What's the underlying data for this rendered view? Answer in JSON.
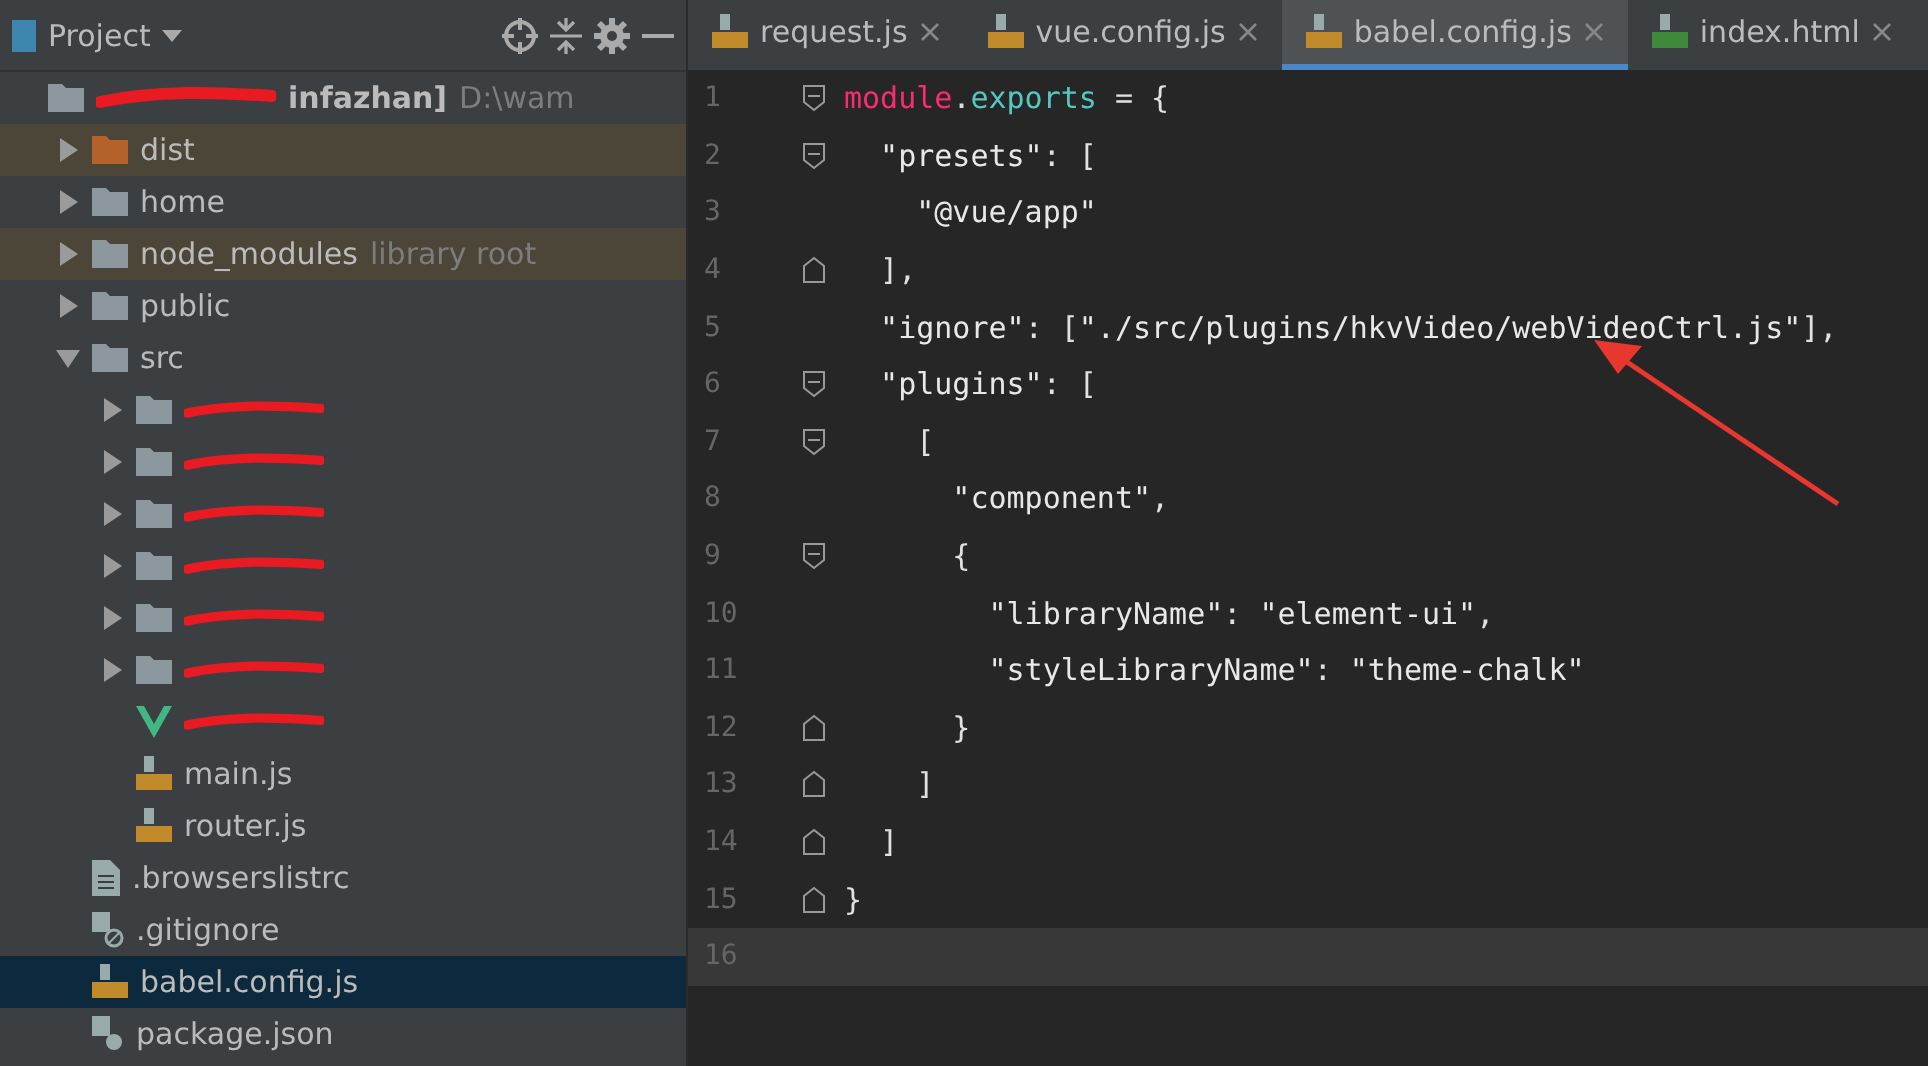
{
  "project_panel": {
    "title": "Project",
    "tree": [
      {
        "name": "infazhan]",
        "kind": "module",
        "redacted": true,
        "note": "D:\\wam",
        "children": [
          {
            "name": "dist",
            "kind": "excluded",
            "expanded": false
          },
          {
            "name": "home",
            "kind": "folder",
            "expanded": false
          },
          {
            "name": "node_modules",
            "kind": "excluded",
            "note": "library root",
            "expanded": false
          },
          {
            "name": "public",
            "kind": "folder",
            "expanded": false
          },
          {
            "name": "src",
            "kind": "folder",
            "expanded": true,
            "children": [
              {
                "kind": "folder",
                "redacted": true,
                "expanded": false
              },
              {
                "kind": "folder",
                "redacted": true,
                "expanded": false
              },
              {
                "kind": "folder",
                "redacted": true,
                "expanded": false
              },
              {
                "kind": "folder",
                "redacted": true,
                "expanded": false
              },
              {
                "kind": "folder",
                "redacted": true,
                "expanded": false
              },
              {
                "kind": "folder",
                "redacted": true,
                "expanded": false
              },
              {
                "kind": "vue",
                "redacted": true
              },
              {
                "name": "main.js",
                "kind": "js"
              },
              {
                "name": "router.js",
                "kind": "js"
              }
            ]
          },
          {
            "name": ".browserslistrc",
            "kind": "text"
          },
          {
            "name": ".gitignore",
            "kind": "ignore"
          },
          {
            "name": "babel.config.js",
            "kind": "js",
            "selected": true
          },
          {
            "name": "package.json",
            "kind": "json"
          }
        ]
      }
    ]
  },
  "tabs": [
    {
      "label": "request.js",
      "kind": "js",
      "selected": false
    },
    {
      "label": "vue.config.js",
      "kind": "js",
      "selected": false
    },
    {
      "label": "babel.config.js",
      "kind": "js",
      "selected": true
    },
    {
      "label": "index.html",
      "kind": "html",
      "selected": false
    }
  ],
  "editor": {
    "lines": [
      {
        "number": "1",
        "fold_start": true,
        "tokens": [
          {
            "text": "module",
            "kind": "kw"
          },
          {
            "text": ".",
            "kind": "punct"
          },
          {
            "text": "exports",
            "kind": "prop"
          },
          {
            "text": " = {",
            "kind": "punct"
          }
        ]
      },
      {
        "number": "2",
        "fold_start": true,
        "tokens": [
          {
            "text": "  \"presets\"",
            "kind": "str"
          },
          {
            "text": ": [",
            "kind": "punct"
          }
        ]
      },
      {
        "number": "3",
        "tokens": [
          {
            "text": "    \"@vue/app\"",
            "kind": "str"
          }
        ]
      },
      {
        "number": "4",
        "fold_end": true,
        "tokens": [
          {
            "text": "  ],",
            "kind": "punct"
          }
        ]
      },
      {
        "number": "5",
        "tokens": [
          {
            "text": "  \"ignore\"",
            "kind": "str"
          },
          {
            "text": ": [",
            "kind": "punct"
          },
          {
            "text": "\"./src/plugins/hkvVideo/webVideoCtrl.js\"",
            "kind": "str"
          },
          {
            "text": "],",
            "kind": "punct"
          }
        ]
      },
      {
        "number": "6",
        "fold_start": true,
        "tokens": [
          {
            "text": "  \"plugins\"",
            "kind": "str"
          },
          {
            "text": ": [",
            "kind": "punct"
          }
        ]
      },
      {
        "number": "7",
        "fold_start": true,
        "tokens": [
          {
            "text": "    [",
            "kind": "punct"
          }
        ]
      },
      {
        "number": "8",
        "tokens": [
          {
            "text": "      \"component\"",
            "kind": "str"
          },
          {
            "text": ",",
            "kind": "punct"
          }
        ]
      },
      {
        "number": "9",
        "fold_start": true,
        "tokens": [
          {
            "text": "      {",
            "kind": "punct"
          }
        ]
      },
      {
        "number": "10",
        "tokens": [
          {
            "text": "        \"libraryName\"",
            "kind": "str"
          },
          {
            "text": ": ",
            "kind": "punct"
          },
          {
            "text": "\"element-ui\"",
            "kind": "str"
          },
          {
            "text": ",",
            "kind": "punct"
          }
        ]
      },
      {
        "number": "11",
        "tokens": [
          {
            "text": "        \"styleLibraryName\"",
            "kind": "str"
          },
          {
            "text": ": ",
            "kind": "punct"
          },
          {
            "text": "\"theme-chalk\"",
            "kind": "str"
          }
        ]
      },
      {
        "number": "12",
        "fold_end": true,
        "tokens": [
          {
            "text": "      }",
            "kind": "punct"
          }
        ]
      },
      {
        "number": "13",
        "fold_end": true,
        "tokens": [
          {
            "text": "    ]",
            "kind": "punct"
          }
        ]
      },
      {
        "number": "14",
        "fold_end": true,
        "tokens": [
          {
            "text": "  ]",
            "kind": "punct"
          }
        ]
      },
      {
        "number": "15",
        "fold_end": true,
        "tokens": [
          {
            "text": "}",
            "kind": "punct"
          }
        ]
      },
      {
        "number": "16",
        "current": true
      }
    ]
  }
}
